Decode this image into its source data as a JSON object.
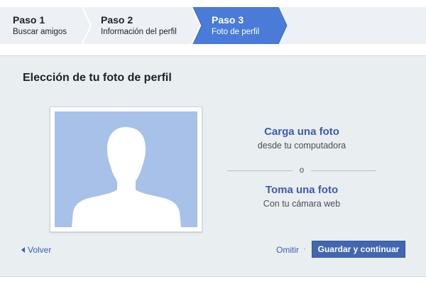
{
  "steps": [
    {
      "number": "Paso 1",
      "label": "Buscar amigos",
      "active": false
    },
    {
      "number": "Paso 2",
      "label": "Información del perfil",
      "active": false
    },
    {
      "number": "Paso 3",
      "label": "Foto de perfil",
      "active": true
    }
  ],
  "panel": {
    "title": "Elección de tu foto de perfil",
    "upload": {
      "link": "Carga una foto",
      "sub": "desde tu computadora"
    },
    "divider": "o",
    "webcam": {
      "link": "Toma una foto",
      "sub": "Con tu cámara web"
    }
  },
  "footer": {
    "back": "Volver",
    "skip": "Omitir",
    "separator": "·",
    "save": "Guardar y continuar"
  },
  "colors": {
    "accent": "#4267b2",
    "link": "#3b5bb5",
    "active_step": "#4a7bd8",
    "photo_bg": "#a8c1e8",
    "panel_bg": "#e9eef1"
  },
  "icons": {
    "back": "caret-left-icon",
    "placeholder": "person-silhouette-icon"
  }
}
